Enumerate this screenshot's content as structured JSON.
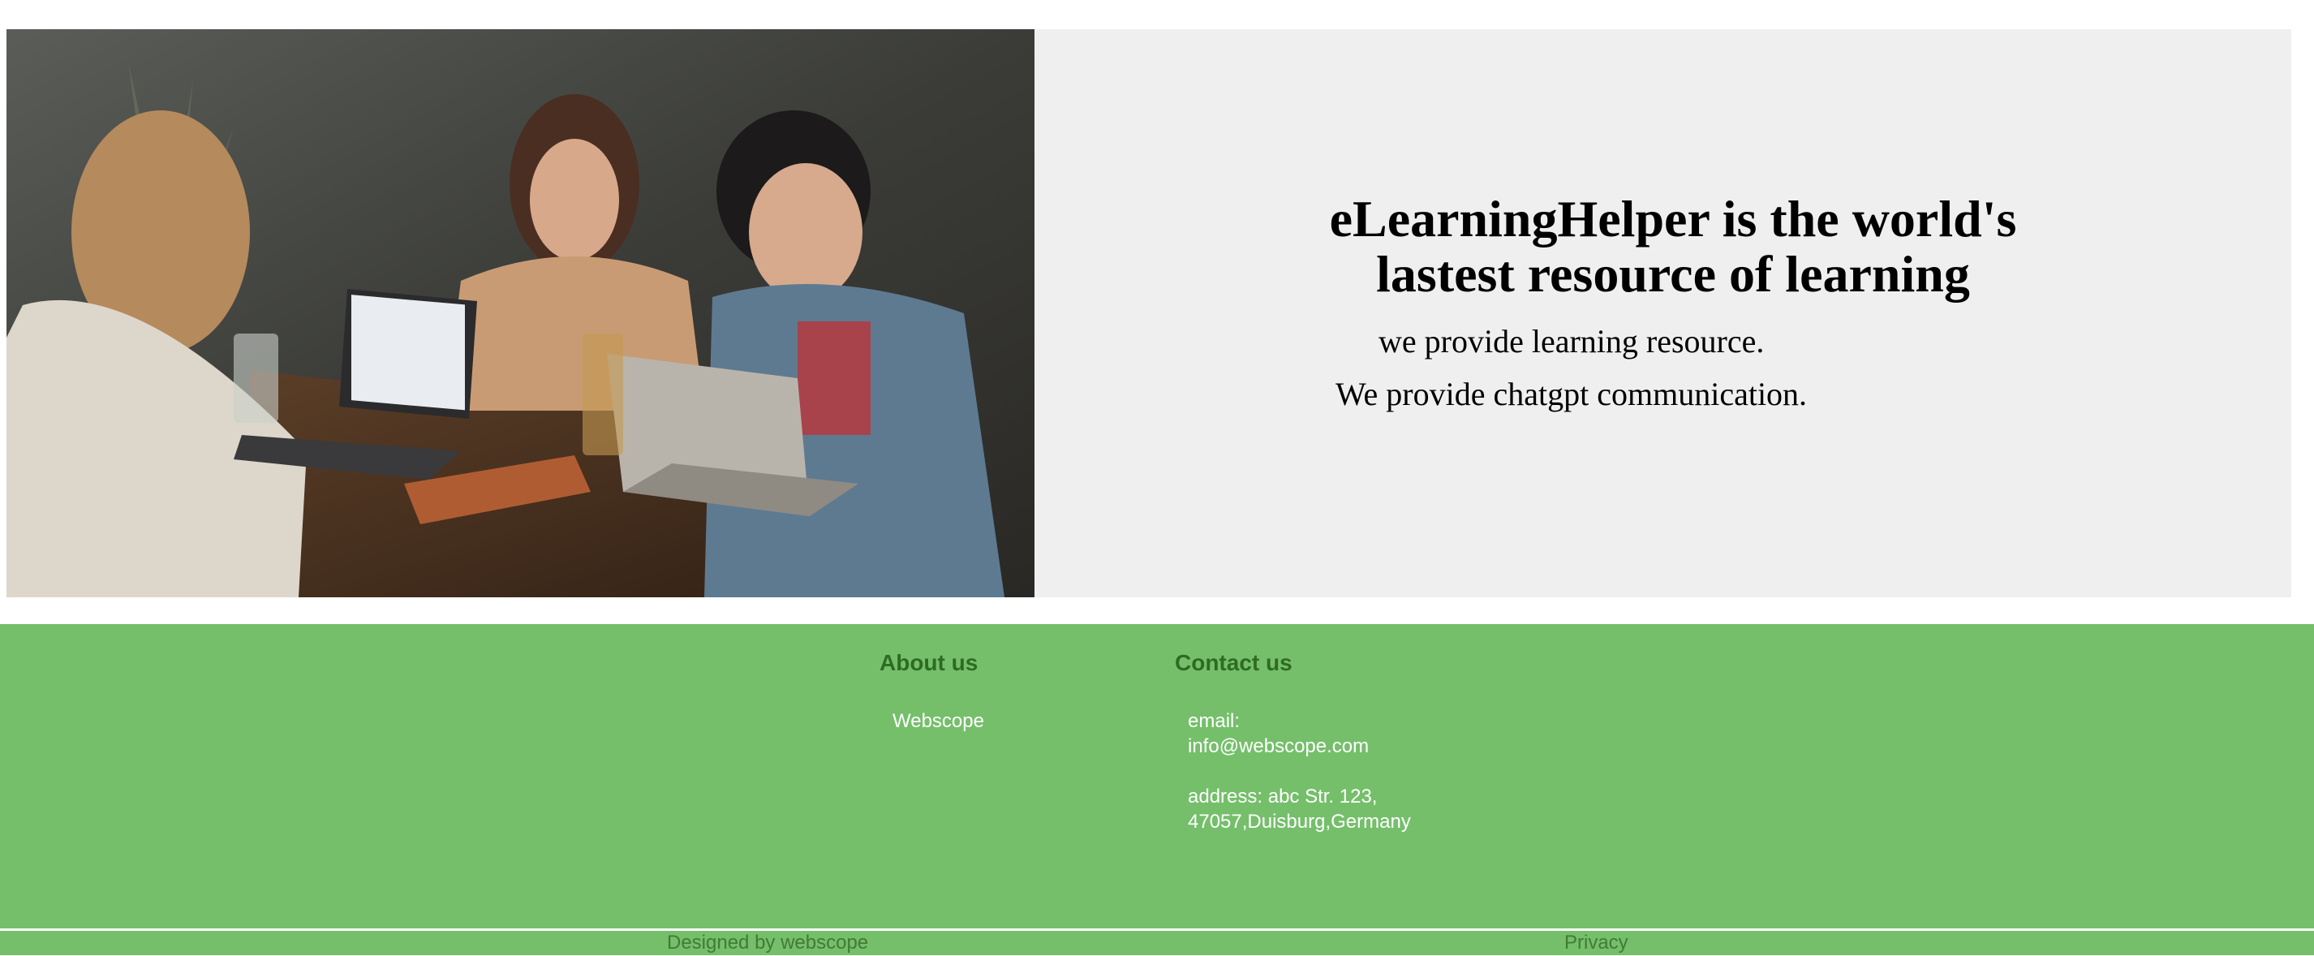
{
  "hero": {
    "image_alt": "Three people laughing around a table with laptops",
    "title": "eLearningHelper is the world's lastest resource of learning",
    "lines": [
      "we provide learning resource.",
      "We provide chatgpt communication."
    ],
    "panel_color": "#efefef"
  },
  "footer": {
    "about": {
      "heading": "About us",
      "text": "Webscope"
    },
    "contact": {
      "heading": "Contact us",
      "email_label": "email:",
      "email": "info@webscope.com",
      "address_line1": "address: abc Str. 123,",
      "address_line2": "47057,Duisburg,Germany"
    },
    "bottom": {
      "designed_by": "Designed by webscope",
      "privacy": "Privacy"
    },
    "colors": {
      "background": "#75bf6b",
      "heading": "#2e6b22",
      "link": "#417a36"
    }
  }
}
